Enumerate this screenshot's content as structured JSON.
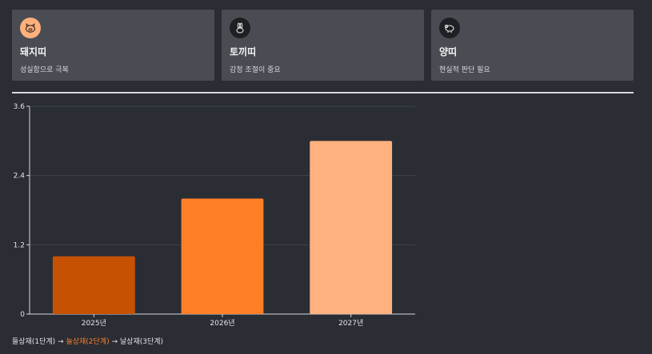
{
  "cards": [
    {
      "title": "돼지띠",
      "desc": "성실함으로 극복",
      "icon": "pig-icon",
      "icon_bg": "#ffb07c",
      "icon_fg": "#3a2a20"
    },
    {
      "title": "토끼띠",
      "desc": "감정 조절이 중요",
      "icon": "rabbit-icon",
      "icon_bg": "#1f2024",
      "icon_fg": "#f0f0f0"
    },
    {
      "title": "양띠",
      "desc": "현실적 판단 필요",
      "icon": "sheep-icon",
      "icon_bg": "#1f2024",
      "icon_fg": "#f0f0f0"
    }
  ],
  "chart_data": {
    "type": "bar",
    "categories": [
      "2025년",
      "2026년",
      "2027년"
    ],
    "values": [
      1,
      2,
      3
    ],
    "colors": [
      "#c65102",
      "#ff7f27",
      "#ffb27f"
    ],
    "ylim": [
      0,
      3.6
    ],
    "yticks": [
      "0",
      "1.2",
      "2.4",
      "3.6"
    ],
    "grid": true
  },
  "legend": {
    "step1": "들상재(1단계)",
    "arrow": "→",
    "step2": "늘상재(2단계)",
    "step3": "날상재(3단계)",
    "highlight_color": "#ff7f27"
  }
}
